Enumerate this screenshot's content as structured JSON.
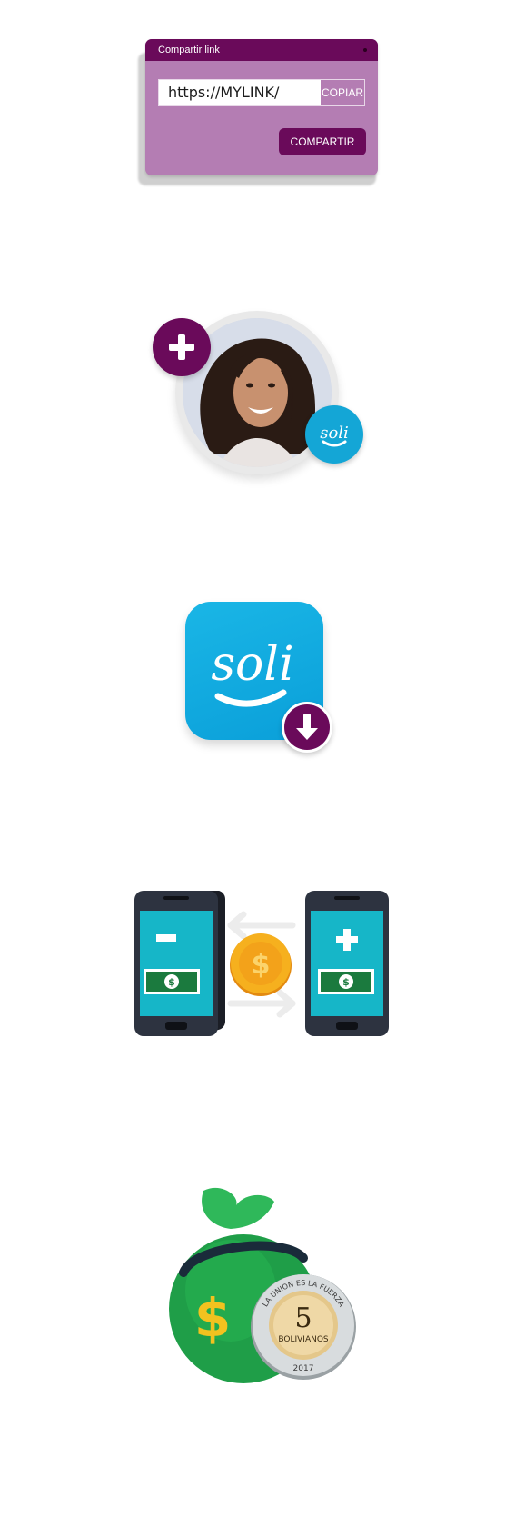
{
  "share_dialog": {
    "title": "Compartir link",
    "link_value": "https://MYLINK/",
    "copy_label": "COPIAR",
    "share_label": "COMPARTIR"
  },
  "avatar_card": {
    "add_icon": "plus-icon",
    "badge_text": "soli"
  },
  "app_icon": {
    "logo_text": "soli",
    "download_icon": "download-arrow-icon"
  },
  "transfer": {
    "minus_icon": "minus-icon",
    "plus_icon": "plus-icon",
    "coin_symbol": "$",
    "bill_symbol": "$"
  },
  "money_bag": {
    "bag_symbol": "$",
    "coin_number": "5",
    "coin_denomination": "BOLIVIANOS",
    "coin_rim_text": "LA UNION ES LA FUERZA",
    "coin_year": "2017"
  },
  "colors": {
    "brand_purple": "#6a0a5a",
    "card_purple": "#b47db3",
    "brand_blue": "#14a6d6",
    "phone_screen": "#14b6c6",
    "bill_green": "#1b7a3e",
    "coin_gold": "#f4a51c",
    "bag_green": "#1f9e48"
  }
}
